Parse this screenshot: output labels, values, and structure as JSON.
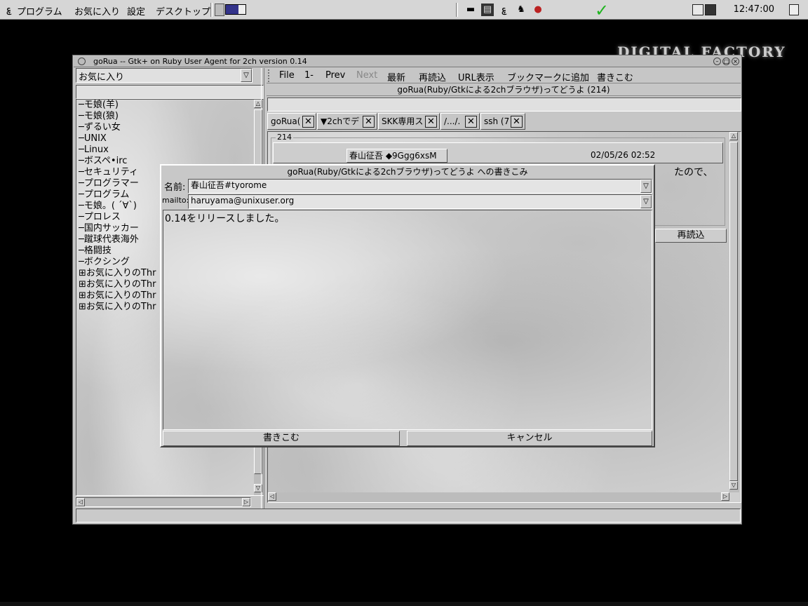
{
  "top_panel": {
    "menus": [
      "プログラム",
      "お気に入り",
      "設定",
      "デスクトップ"
    ],
    "clock": "12:47:00"
  },
  "desktop": {
    "logo": "DIGITAL FACTORY"
  },
  "window": {
    "title": "goRua -- Gtk+ on Ruby User Agent for 2ch version 0.14",
    "left_pane": {
      "combo_value": "お気に入り",
      "tree_items": [
        "─モ娘(羊)",
        "─モ娘(狼)",
        "─ずるい女",
        "─UNIX",
        "─Linux",
        "─ボスペ•irc",
        "─セキュリティ",
        "─プログラマー",
        "─プログラム",
        "─モ娘。( ´∀`)",
        "─プロレス",
        "─国内サッカー",
        "─蹴球代表海外",
        "─格闘技",
        "─ボクシング",
        "⊞お気に入りのThr",
        "⊞お気に入りのThr",
        "⊞お気に入りのThr",
        "⊞お気に入りのThr"
      ]
    },
    "menubar": {
      "file": "File",
      "first": "1-",
      "prev": "Prev",
      "next": "Next",
      "latest": "最新",
      "reload": "再読込",
      "url": "URL表示",
      "bookmark": "ブックマークに追加",
      "write": "書きこむ"
    },
    "thread_title": "goRua(Ruby/Gtkによる2chブラウザ)ってどうよ (214)",
    "tabs": [
      "goRua(",
      "▼2chでデ",
      "SKK専用ス",
      "/.../.",
      "ssh (7"
    ],
    "post": {
      "number": "214",
      "name": "春山征吾 ◆9Ggg6xsM",
      "date": "02/05/26 02:52",
      "body_fragment": "たので、",
      "reload_button": "再読込"
    }
  },
  "dialog": {
    "title": "goRua(Ruby/Gtkによる2chブラウザ)ってどうよ への書きこみ",
    "name_label": "名前",
    "name_value": "春山征吾#tyorome",
    "mail_label": "mailto",
    "mail_value": "haruyama@unixuser.org",
    "message": "0.14をリリースしました。",
    "submit_label": "書きこむ",
    "cancel_label": "キャンセル"
  }
}
